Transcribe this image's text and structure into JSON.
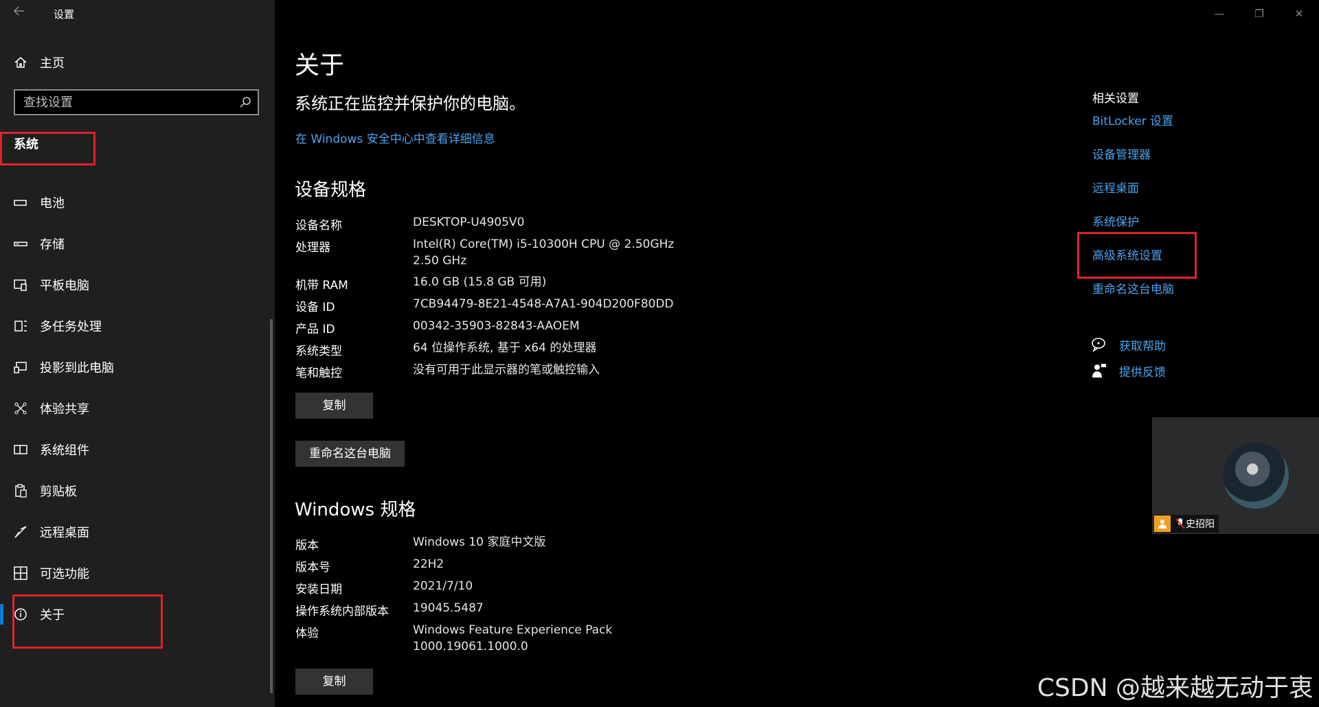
{
  "window": {
    "title": "设置",
    "minimize": "—",
    "restore": "❐",
    "close": "✕"
  },
  "sidebar": {
    "home": "主页",
    "search_placeholder": "查找设置",
    "section": "系统",
    "items": [
      {
        "label": "电池",
        "icon": "battery-icon"
      },
      {
        "label": "存储",
        "icon": "storage-icon"
      },
      {
        "label": "平板电脑",
        "icon": "tablet-icon"
      },
      {
        "label": "多任务处理",
        "icon": "multitasking-icon"
      },
      {
        "label": "投影到此电脑",
        "icon": "projecting-icon"
      },
      {
        "label": "体验共享",
        "icon": "share-experience-icon"
      },
      {
        "label": "系统组件",
        "icon": "system-components-icon"
      },
      {
        "label": "剪贴板",
        "icon": "clipboard-icon"
      },
      {
        "label": "远程桌面",
        "icon": "remote-desktop-icon"
      },
      {
        "label": "可选功能",
        "icon": "optional-features-icon"
      },
      {
        "label": "关于",
        "icon": "info-icon",
        "selected": true
      }
    ]
  },
  "main": {
    "title": "关于",
    "protect_text": "系统正在监控并保护你的电脑。",
    "security_link": "在 Windows 安全中心中查看详细信息",
    "device_specs": {
      "heading": "设备规格",
      "rows": [
        {
          "k": "设备名称",
          "v": "DESKTOP-U4905V0"
        },
        {
          "k": "处理器",
          "v": "Intel(R) Core(TM) i5-10300H CPU @ 2.50GHz   2.50 GHz"
        },
        {
          "k": "机带 RAM",
          "v": "16.0 GB (15.8 GB 可用)"
        },
        {
          "k": "设备 ID",
          "v": "7CB94479-8E21-4548-A7A1-904D200F80DD"
        },
        {
          "k": "产品 ID",
          "v": "00342-35903-82843-AAOEM"
        },
        {
          "k": "系统类型",
          "v": "64 位操作系统, 基于 x64 的处理器"
        },
        {
          "k": "笔和触控",
          "v": "没有可用于此显示器的笔或触控输入"
        }
      ],
      "copy_button": "复制",
      "rename_button": "重命名这台电脑"
    },
    "windows_specs": {
      "heading": "Windows 规格",
      "rows": [
        {
          "k": "版本",
          "v": "Windows 10 家庭中文版"
        },
        {
          "k": "版本号",
          "v": "22H2"
        },
        {
          "k": "安装日期",
          "v": "2021/7/10"
        },
        {
          "k": "操作系统内部版本",
          "v": "19045.5487"
        },
        {
          "k": "体验",
          "v": "Windows Feature Experience Pack 1000.19061.1000.0"
        }
      ],
      "copy_button": "复制"
    }
  },
  "related": {
    "heading": "相关设置",
    "links": [
      "BitLocker 设置",
      "设备管理器",
      "远程桌面",
      "系统保护",
      "高级系统设置",
      "重命名这台电脑"
    ],
    "help": "获取帮助",
    "feedback": "提供反馈"
  },
  "video": {
    "user_name": "史招阳"
  },
  "watermark": "CSDN @越来越无动于衷",
  "colors": {
    "accent": "#4aa3f0",
    "highlight_box": "#e0232b",
    "selected_bar": "#0a7ad6"
  }
}
